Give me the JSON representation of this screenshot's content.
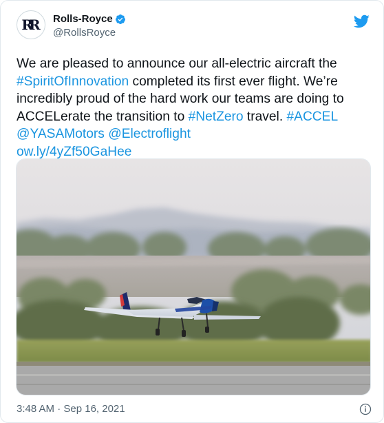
{
  "account": {
    "display_name": "Rolls-Royce",
    "handle": "@RollsRoyce",
    "avatar_monogram": "RR",
    "verified": true
  },
  "tweet": {
    "t1": "We are pleased to announce our all-electric aircraft the ",
    "tag_spirit": "#SpiritOfInnovation",
    "t2": " completed its first ever flight. We’re incredibly proud of the hard work our teams are doing to ACCELerate the transition to ",
    "tag_netzero": "#NetZero",
    "t3": " travel. ",
    "tag_accel": "#ACCEL",
    "mention_yasa": "@YASAMotors",
    "mention_electroflight": "@Electroflight",
    "link": "ow.ly/4yZf50GaHee"
  },
  "footer": {
    "timestamp": "3:48 AM · Sep 16, 2021"
  },
  "icons": {
    "bird": "twitter-bird-icon",
    "verified": "verified-badge-icon",
    "info": "info-icon"
  },
  "colors": {
    "link": "#1b95e0",
    "twitter_blue": "#1d9bf0",
    "text": "#0f1419",
    "secondary": "#536471"
  }
}
